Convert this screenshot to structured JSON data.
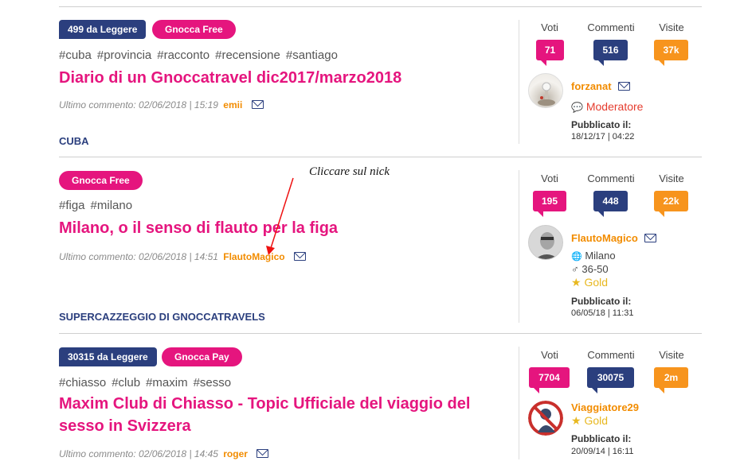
{
  "stat_headers": {
    "votes": "Voti",
    "comments": "Commenti",
    "visits": "Visite"
  },
  "labels": {
    "published": "Pubblicato il:",
    "last_comment_prefix": "Ultimo commento:"
  },
  "sections": [
    "CUBA",
    "SUPERCAZZEGGIO DI GNOCCATRAVELS"
  ],
  "annotation": "Cliccare sul nick",
  "colors": {
    "pink": "#e5157e",
    "navy": "#2b3f7e",
    "orange": "#f7941d",
    "gold": "#e8b820"
  },
  "threads": [
    {
      "badge_read": "499 da Leggere",
      "badge_type": "Gnocca Free",
      "tags": [
        "#cuba",
        "#provincia",
        "#racconto",
        "#recensione",
        "#santiago"
      ],
      "title": "Diario di un Gnoccatravel dic2017/marzo2018",
      "last_comment": "02/06/2018 | 15:19",
      "last_nick": "emii",
      "votes": "71",
      "comments": "516",
      "visits": "37k",
      "author": "forzanat",
      "role": "Moderatore",
      "published": "18/12/17 | 04:22"
    },
    {
      "badge_type": "Gnocca Free",
      "tags": [
        "#figa",
        "#milano"
      ],
      "title": "Milano, o il senso di flauto per la figa",
      "last_comment": "02/06/2018 | 14:51",
      "last_nick": "FlautoMagico",
      "votes": "195",
      "comments": "448",
      "visits": "22k",
      "author": "FlautoMagico",
      "city": "Milano",
      "age": "36-50",
      "level": "Gold",
      "published": "06/05/18 | 11:31"
    },
    {
      "badge_read": "30315 da Leggere",
      "badge_type": "Gnocca Pay",
      "tags": [
        "#chiasso",
        "#club",
        "#maxim",
        "#sesso"
      ],
      "title": "Maxim Club di Chiasso - Topic Ufficiale del viaggio del sesso in Svizzera",
      "last_comment": "02/06/2018 | 14:45",
      "last_nick": "roger",
      "votes": "7704",
      "comments": "30075",
      "visits": "2m",
      "author": "Viaggiatore29",
      "level": "Gold",
      "published": "20/09/14 | 16:11"
    }
  ]
}
